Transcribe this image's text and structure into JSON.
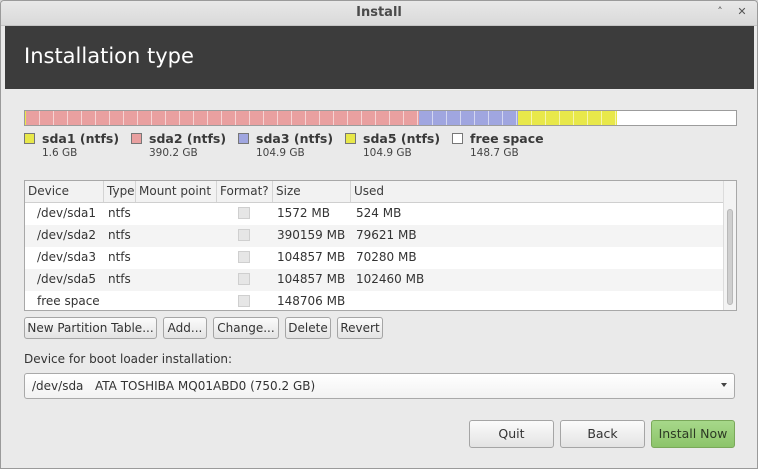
{
  "window": {
    "title": "Install"
  },
  "header": {
    "title": "Installation type"
  },
  "disk_bar": {
    "segments": [
      {
        "name": "sda1",
        "fraction": 0.0021,
        "color": "#e8e84a"
      },
      {
        "name": "sda2",
        "fraction": 0.5517,
        "color": "#e9a0a0"
      },
      {
        "name": "sda3",
        "fraction": 0.1397,
        "color": "#a0a6e0"
      },
      {
        "name": "sda5",
        "fraction": 0.1397,
        "color": "#e8e84a"
      },
      {
        "name": "free space",
        "fraction": 0.1668,
        "color": "#ffffff"
      }
    ]
  },
  "legend": [
    {
      "name": "sda1 (ntfs)",
      "size": "1.6 GB",
      "color": "#e8e84a"
    },
    {
      "name": "sda2 (ntfs)",
      "size": "390.2 GB",
      "color": "#e9a0a0"
    },
    {
      "name": "sda3 (ntfs)",
      "size": "104.9 GB",
      "color": "#a0a6e0"
    },
    {
      "name": "sda5 (ntfs)",
      "size": "104.9 GB",
      "color": "#e8e84a"
    },
    {
      "name": "free space",
      "size": "148.7 GB",
      "color": "#ffffff"
    }
  ],
  "partition_table": {
    "columns": [
      "Device",
      "Type",
      "Mount point",
      "Format?",
      "Size",
      "Used"
    ],
    "rows": [
      {
        "device": "/dev/sda1",
        "type": "ntfs",
        "mount": "",
        "size": "1572 MB",
        "used": "524 MB"
      },
      {
        "device": "/dev/sda2",
        "type": "ntfs",
        "mount": "",
        "size": "390159 MB",
        "used": "79621 MB"
      },
      {
        "device": "/dev/sda3",
        "type": "ntfs",
        "mount": "",
        "size": "104857 MB",
        "used": "70280 MB"
      },
      {
        "device": "/dev/sda5",
        "type": "ntfs",
        "mount": "",
        "size": "104857 MB",
        "used": "102460 MB"
      },
      {
        "device": "free space",
        "type": "",
        "mount": "",
        "size": "148706 MB",
        "used": ""
      }
    ]
  },
  "partition_buttons": {
    "new_table": "New Partition Table...",
    "add": "Add...",
    "change": "Change...",
    "delete": "Delete",
    "revert": "Revert"
  },
  "boot_loader": {
    "label": "Device for boot loader installation:",
    "device": "/dev/sda",
    "model": "ATA TOSHIBA MQ01ABD0 (750.2 GB)"
  },
  "actions": {
    "quit": "Quit",
    "back": "Back",
    "install": "Install Now"
  },
  "colors": {
    "banner": "#3c3c3c",
    "install_button": "#8cc46a"
  }
}
